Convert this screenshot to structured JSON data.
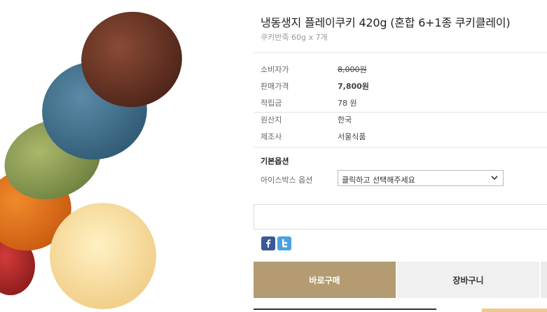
{
  "product": {
    "title": "냉동생지 플레이쿠키 420g (혼합 6+1종 쿠키클레이)",
    "subtitle": "쿠키반죽 60g x 7개"
  },
  "details": [
    {
      "label": "소비자가",
      "value": "8,000원"
    },
    {
      "label": "판매가격",
      "value": "7,800원"
    },
    {
      "label": "적립금",
      "value": "78 원"
    },
    {
      "label": "원산지",
      "value": "한국"
    },
    {
      "label": "제조사",
      "value": "서울식품"
    }
  ],
  "options": {
    "section_title": "기본옵션",
    "label": "아이스박스 옵션",
    "selected": "클릭하고 선택해주세요"
  },
  "social": [
    {
      "icon": "facebook-icon",
      "color": "#3b5998"
    },
    {
      "icon": "twitter-icon",
      "color": "#4aa3df"
    }
  ],
  "actions": {
    "buy_label": "바로구매",
    "cart_label": "장바구니"
  },
  "colors": {
    "buy_button": "#b49b72",
    "cart_button": "#f0f0f0"
  }
}
